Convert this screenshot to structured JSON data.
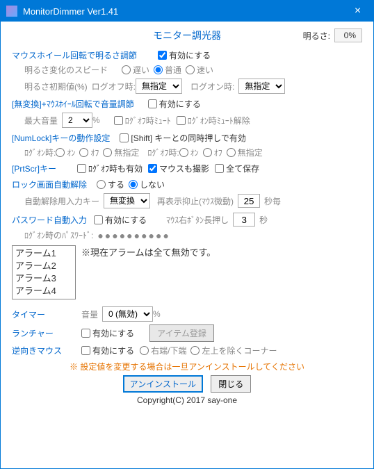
{
  "titlebar": {
    "title": "MonitorDimmer Ver1.41"
  },
  "header": {
    "title": "モニター調光器",
    "brightness_label": "明るさ:",
    "brightness_value": "0%"
  },
  "wheel": {
    "title": "マウスホイール回転で明るさ調節",
    "enable": "有効にする",
    "speed_label": "明るさ変化のスピード",
    "speed_slow": "遅い",
    "speed_normal": "普通",
    "speed_fast": "速い",
    "init_label": "明るさ初期値(%)",
    "logoff_label": "ログオフ時:",
    "logon_label": "ログオン時:",
    "unspecified": "無指定"
  },
  "volume": {
    "title_key": "[無変換]",
    "plus": " + ",
    "title_rest": "ﾏｳｽﾎｲｰﾙ回転で音量調節",
    "enable": "有効にする",
    "max_label": "最大音量",
    "max_value": "2",
    "pct": "%",
    "mute_logoff": "ﾛｸﾞｵﾌ時ﾐｭｰﾄ",
    "mute_logon": "ﾛｸﾞｵﾝ時ﾐｭｰﾄ解除"
  },
  "numlock": {
    "title_key": "[NumLock]",
    "title_rest": " キーの動作設定",
    "shift": "[Shift] キーとの同時押しで有効",
    "logon": "ﾛｸﾞｵﾝ時:",
    "logoff": "ﾛｸﾞｵﾌ時:",
    "on": "ｵﾝ",
    "off": "ｵﾌ",
    "none": "無指定"
  },
  "prtscr": {
    "title_key": "[PrtScr]",
    "title_rest": " キー",
    "logoff_valid": "ﾛｸﾞｵﾌ時も有効",
    "mouse_capture": "マウスも撮影",
    "save_all": "全て保存"
  },
  "lock": {
    "title": "ロック画面自動解除",
    "do": "する",
    "dont": "しない",
    "key_label": "自動解除用入力キー",
    "key_value": "無変換",
    "suppress_label": "再表示抑止(ﾏｳｽ微動)",
    "suppress_value": "25",
    "sec": "秒毎"
  },
  "password": {
    "title": "パスワード自動入力",
    "enable": "有効にする",
    "rclick_label": "ﾏｳｽ右ﾎﾞﾀﾝ長押し",
    "rclick_value": "3",
    "sec": "秒",
    "pw_label": "ﾛｸﾞｵﾝ時のﾊﾟｽﾜｰﾄﾞ:",
    "dots": "●●●●●●●●●●"
  },
  "alarm": {
    "items": [
      "アラーム1",
      "アラーム2",
      "アラーム3",
      "アラーム4"
    ],
    "note": "※現在アラームは全て無効です。"
  },
  "timer": {
    "label": "タイマー",
    "vol_label": "音量",
    "vol_value": "0 (無効)",
    "pct": "%"
  },
  "launcher": {
    "label": "ランチャー",
    "enable": "有効にする",
    "register": "アイテム登録"
  },
  "reverse": {
    "label": "逆向きマウス",
    "enable": "有効にする",
    "rb": "右端/下端",
    "tl": "左上を除くコーナー"
  },
  "warn": "※ 設定値を変更する場合は一旦アンインストールしてください",
  "footer": {
    "uninstall": "アンインストール",
    "close": "閉じる",
    "copyright": "Copyright(C) 2017 say-one"
  }
}
